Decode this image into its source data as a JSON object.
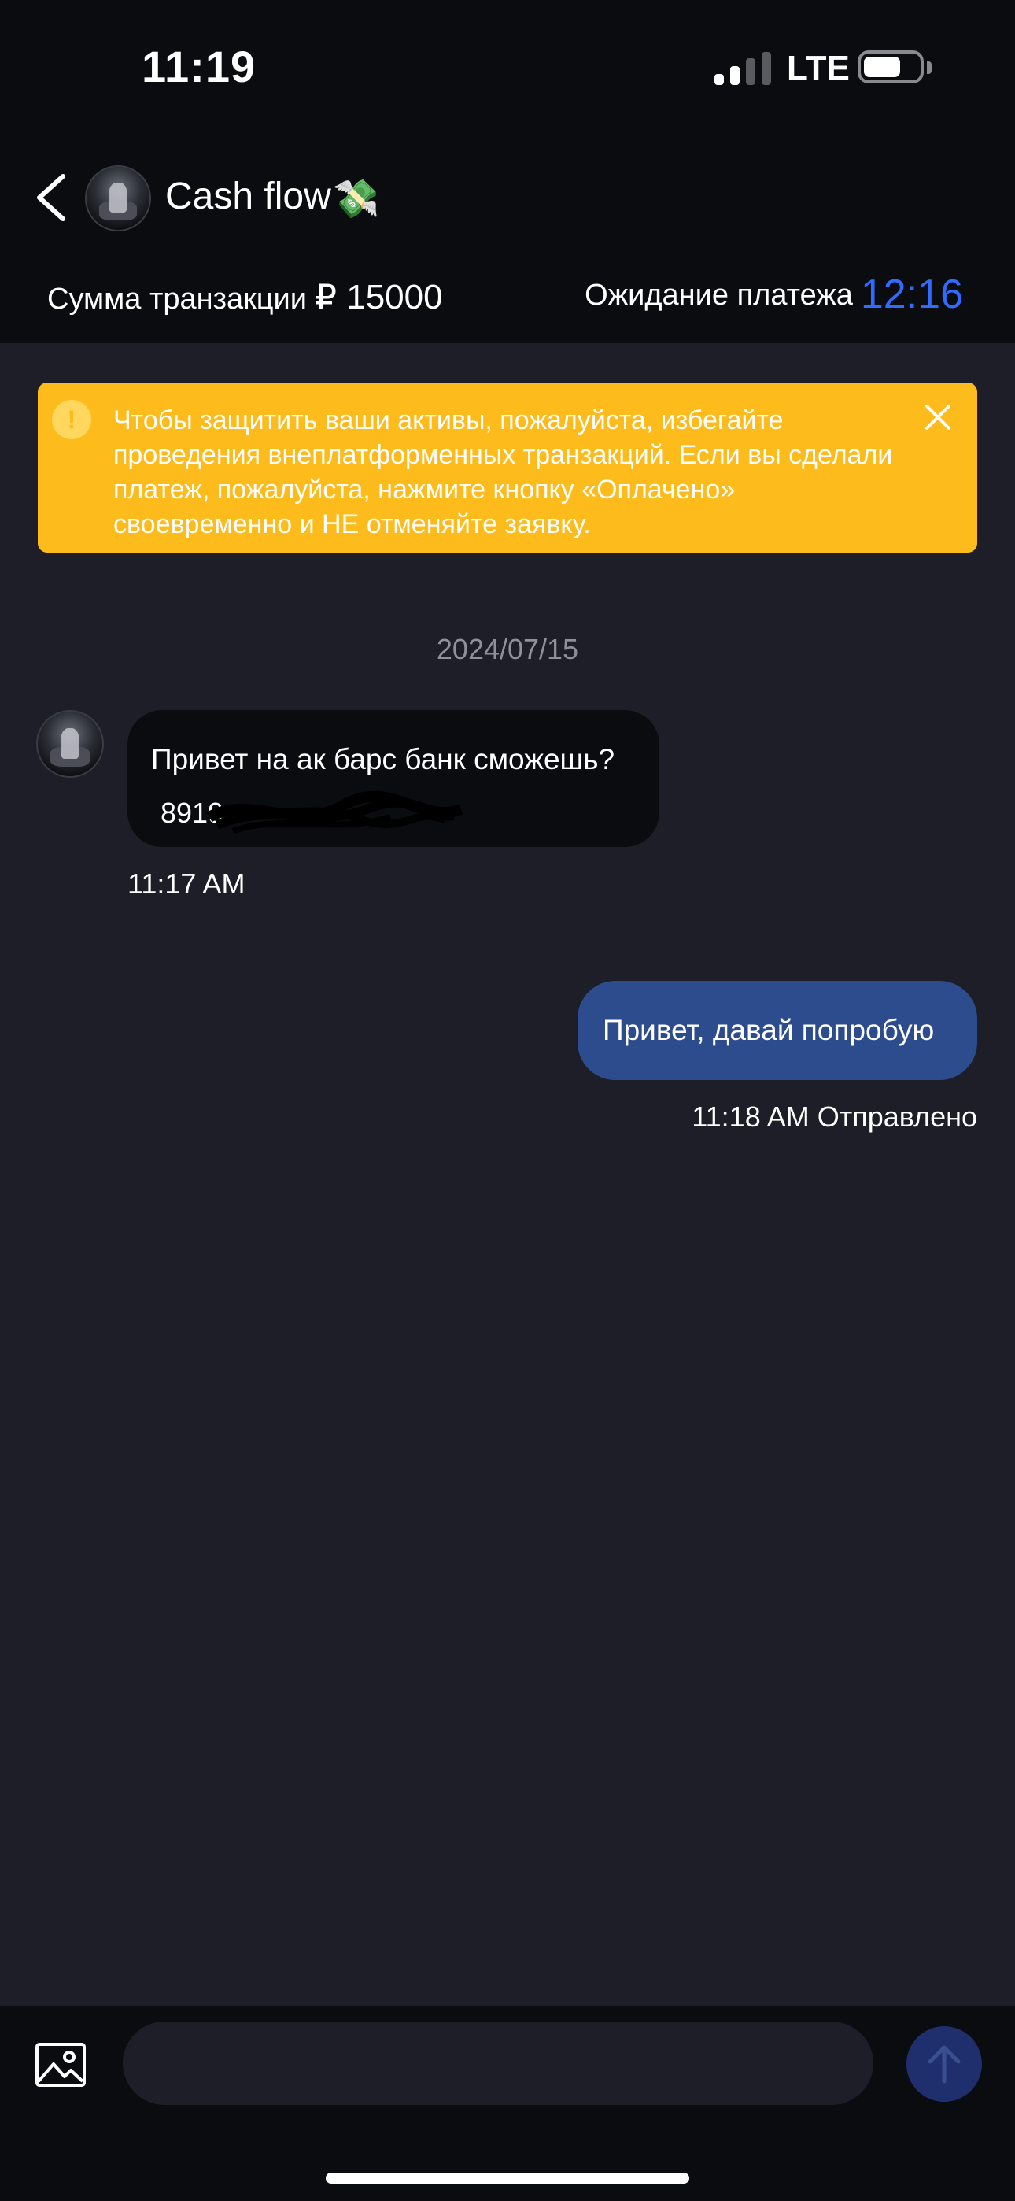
{
  "status_bar": {
    "time": "11:19",
    "network": "LTE"
  },
  "header": {
    "title": "Cash flow",
    "title_emoji": "💸",
    "transaction_label": "Сумма транзакции",
    "transaction_amount": "₽ 15000",
    "waiting_label": "Ожидание платежа",
    "waiting_timer": "12:16"
  },
  "warning": {
    "text": "Чтобы защитить ваши активы, пожалуйста, избегайте проведения внеплатформенных транзакций. Если вы сделали платеж, пожалуйста, нажмите кнопку «Оплачено» своевременно и НЕ отменяйте заявку."
  },
  "chat": {
    "date": "2024/07/15",
    "messages": [
      {
        "direction": "incoming",
        "text": "Привет на ак барс банк сможешь?",
        "text2": "8919",
        "time": "11:17 AM"
      },
      {
        "direction": "outgoing",
        "text": "Привет, давай попробую",
        "time": "11:18 AM Отправлено"
      }
    ]
  },
  "composer": {
    "placeholder": ""
  },
  "colors": {
    "accent": "#2f6bff",
    "warning_bg": "#fdbb1c",
    "outgoing_bubble": "#2d4c8e",
    "background": "#1d1e28",
    "bar": "#0b0c0f"
  },
  "icons": [
    "back-chevron-icon",
    "info-icon",
    "close-icon",
    "gallery-icon",
    "send-arrow-icon"
  ]
}
